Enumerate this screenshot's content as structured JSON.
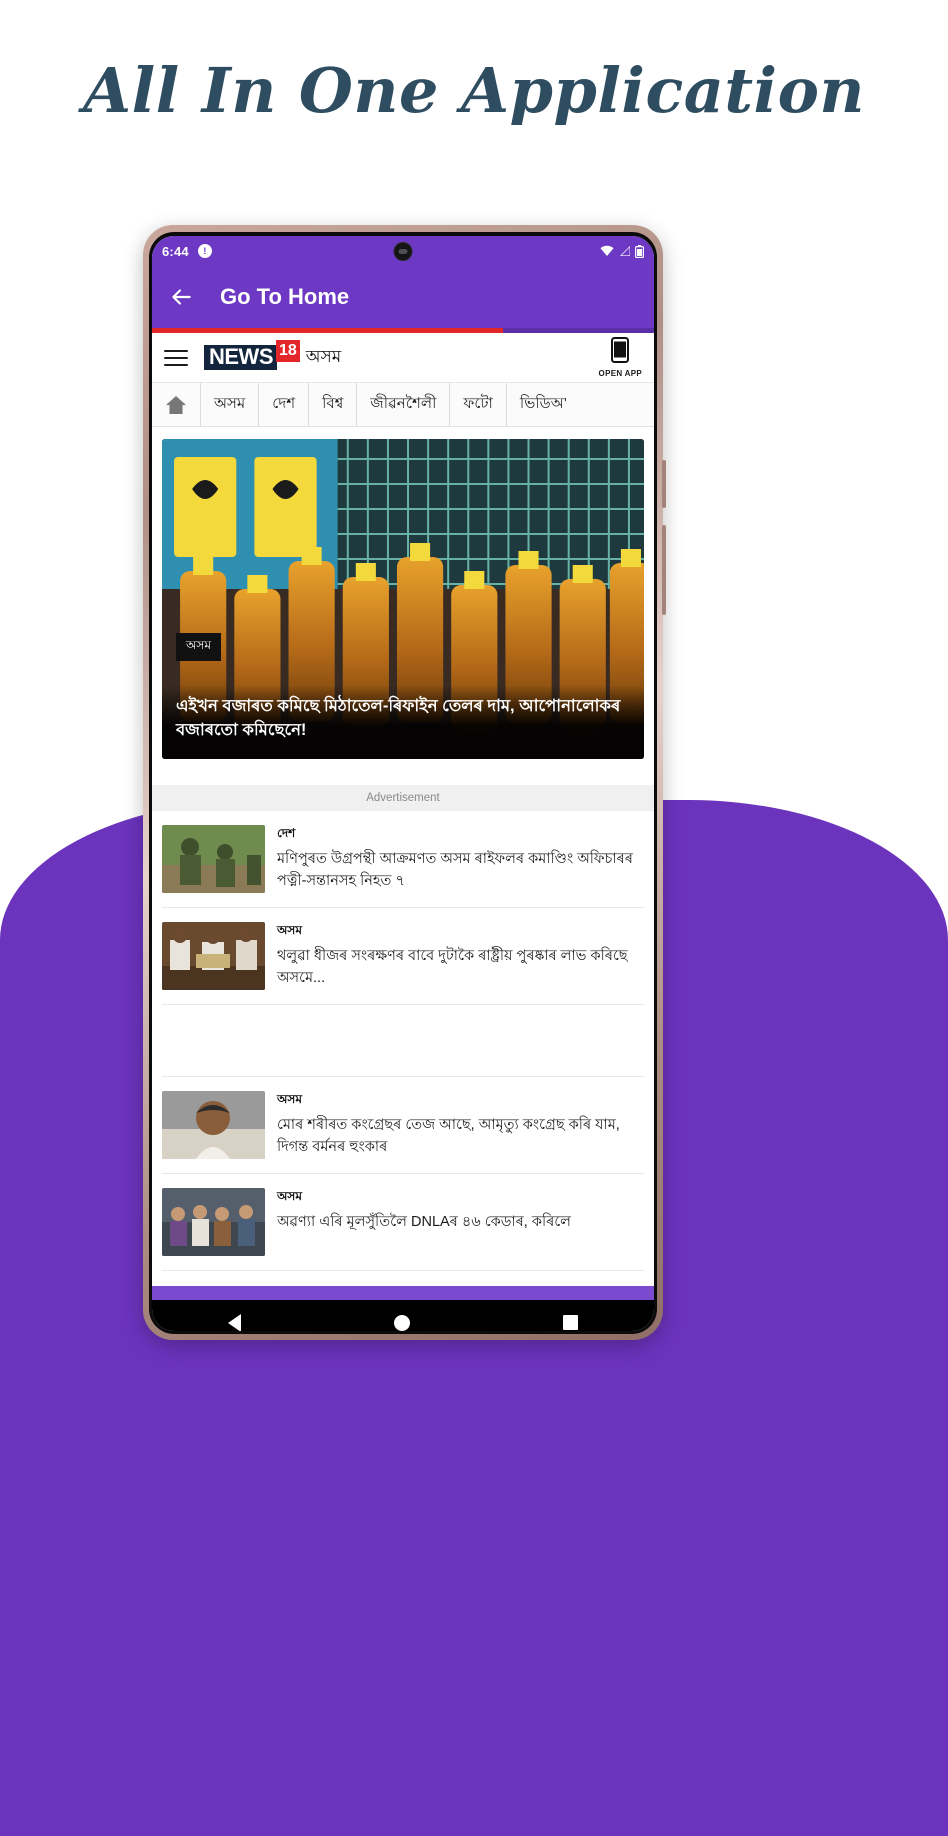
{
  "hero": {
    "title": "All In One Application",
    "title_color": "#2e4d60"
  },
  "phone": {
    "statusbar": {
      "time": "6:44",
      "notification_badge": "!",
      "icons": [
        "wifi-icon",
        "signal-icon",
        "battery-icon"
      ]
    },
    "appbar": {
      "title": "Go To Home",
      "back_icon": "back-arrow-icon",
      "background_color": "#6d39c4"
    },
    "progress": {
      "percent": 70,
      "fill_color": "#e02626",
      "track_color": "#5b2fa8"
    }
  },
  "site": {
    "menu_icon": "hamburger-icon",
    "brand": {
      "word": "NEWS",
      "number": "18",
      "language": "অসম"
    },
    "open_app": {
      "label": "OPEN APP",
      "icon": "mobile-phone-icon"
    },
    "categories": [
      {
        "label": "home-icon",
        "type": "icon",
        "name": "home"
      },
      {
        "label": "অসম",
        "type": "text"
      },
      {
        "label": "দেশ",
        "type": "text"
      },
      {
        "label": "বিশ্ব",
        "type": "text"
      },
      {
        "label": "জীৱনশৈলী",
        "type": "text"
      },
      {
        "label": "ফটো",
        "type": "text"
      },
      {
        "label": "ভিডিঅ’",
        "type": "text"
      }
    ],
    "hero_article": {
      "tag": "অসম",
      "headline": "এইখন বজাৰত কমিছে মিঠাতেল-ৰিফাইন তেলৰ দাম, আপোনালোকৰ বজাৰতো কমিছেনে!",
      "image_alt": "oil-bottles-photo"
    },
    "advertisement_label": "Advertisement",
    "articles": [
      {
        "category": "দেশ",
        "title": "মণিপুৰত উগ্ৰপন্থী আক্ৰমণত অসম ৰাইফলৰ কমাণ্ডিং অফিচাৰৰ পত্নী-সন্তানসহ নিহত ৭",
        "thumb": "soldiers-photo"
      },
      {
        "category": "অসম",
        "title": "থলুৱা ধীজৰ সংৰক্ষণৰ বাবে দুটাকৈ ৰাষ্ট্ৰীয় পুৰষ্কাৰ লাভ কৰিছে অসমে...",
        "thumb": "award-photo"
      },
      {
        "category": "",
        "title": "",
        "thumb": "blank-placeholder"
      },
      {
        "category": "অসম",
        "title": "মোৰ শৰীৰত কংগ্ৰেছৰ তেজ আছে, আমৃত্যু কংগ্ৰেছ কৰি যাম, দিগন্ত বৰ্মনৰ হুংকাৰ",
        "thumb": "politician-photo"
      },
      {
        "category": "অসম",
        "title": "অৱণ্যা এৰি মূলসুঁতিলৈ DNLAৰ ৪৬ কেডাৰ, কৰিলে",
        "thumb": "group-photo"
      }
    ]
  },
  "navbar": {
    "back": "nav-back-icon",
    "home": "nav-home-icon",
    "recents": "nav-recents-icon"
  },
  "colors": {
    "purple": "#6c33bd",
    "appbar_purple": "#6d39c4",
    "brand_red": "#e4262b",
    "brand_navy": "#13243d"
  }
}
